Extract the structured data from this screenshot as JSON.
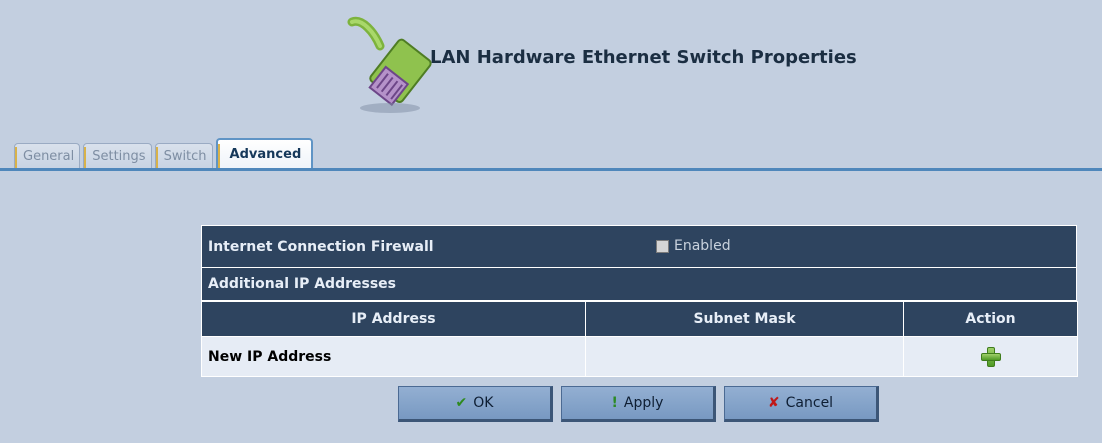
{
  "header": {
    "title": "LAN Hardware Ethernet Switch Properties",
    "icon": "ethernet-cable-icon"
  },
  "tabs": [
    {
      "label": "General",
      "active": false
    },
    {
      "label": "Settings",
      "active": false
    },
    {
      "label": "Switch",
      "active": false
    },
    {
      "label": "Advanced",
      "active": true
    }
  ],
  "firewall": {
    "label": "Internet Connection Firewall",
    "checkbox_label": "Enabled",
    "checked": false
  },
  "additional_ips": {
    "section_label": "Additional IP Addresses",
    "columns": [
      "IP Address",
      "Subnet Mask",
      "Action"
    ],
    "rows": [
      {
        "ip": "New IP Address",
        "mask": "",
        "action_icon": "add-icon"
      }
    ]
  },
  "buttons": {
    "ok": {
      "label": "OK",
      "glyph": "✔"
    },
    "apply": {
      "label": "Apply",
      "glyph": "!"
    },
    "cancel": {
      "label": "Cancel",
      "glyph": "✘"
    }
  },
  "colors": {
    "background": "#c3cfe0",
    "dark_header": "#2e445f",
    "tab_line": "#4f87bb"
  }
}
